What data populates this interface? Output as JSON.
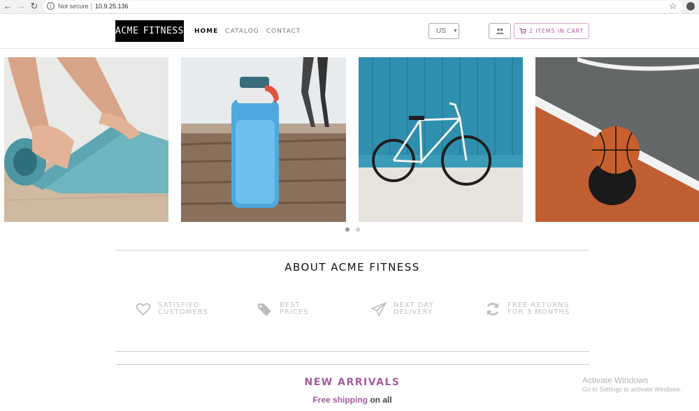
{
  "browser": {
    "security_label": "Not secure",
    "url": "10.9.25.136"
  },
  "header": {
    "logo_left": "ACME",
    "logo_right": "FITNESS",
    "nav": [
      {
        "label": "HOME",
        "active": true
      },
      {
        "label": "CATALOG",
        "active": false
      },
      {
        "label": "CONTACT",
        "active": false
      }
    ],
    "currency": "US",
    "cart_label": "2 ITEMS IN CART"
  },
  "carousel": {
    "slides": [
      "yoga-mat-image",
      "water-bottle-image",
      "bicycle-image",
      "basketball-image"
    ],
    "active_dot": 0,
    "dot_count": 2
  },
  "about": {
    "title": "ABOUT ACME FITNESS",
    "features": [
      {
        "icon": "heart-icon",
        "line1": "SATISFIED",
        "line2": "CUSTOMERS"
      },
      {
        "icon": "tags-icon",
        "line1": "BEST",
        "line2": "PRICES"
      },
      {
        "icon": "paper-plane-icon",
        "line1": "NEXT DAY",
        "line2": "DELIVERY"
      },
      {
        "icon": "refresh-icon",
        "line1": "FREE RETURNS",
        "line2": "FOR 3 MONTHS"
      }
    ]
  },
  "arrivals": {
    "title": "NEW ARRIVALS",
    "shipping_highlight": "Free shipping",
    "shipping_rest": "on all"
  },
  "watermark": {
    "line1": "Activate Windows",
    "line2": "Go to Settings to activate Windows."
  },
  "colors": {
    "accent": "#a65a9e"
  }
}
